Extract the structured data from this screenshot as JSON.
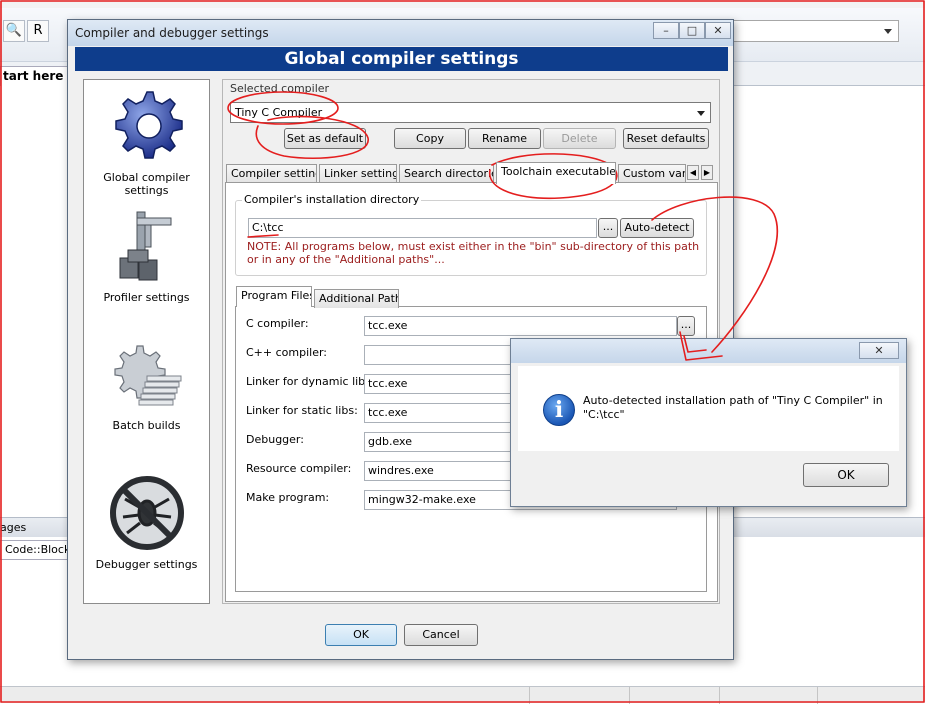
{
  "ide": {
    "tab_label": "tart here",
    "logs_header": "ages",
    "logs_tab": "Code::Blocks"
  },
  "dialog": {
    "title": "Compiler and debugger settings",
    "header": "Global compiler settings",
    "side_items": [
      {
        "label": "Global compiler settings",
        "icon": "gear-icon"
      },
      {
        "label": "Profiler settings",
        "icon": "caliper-icon"
      },
      {
        "label": "Batch builds",
        "icon": "batch-gear-icon"
      },
      {
        "label": "Debugger settings",
        "icon": "no-bug-icon"
      }
    ],
    "selected_compiler_label": "Selected compiler",
    "selected_compiler_value": "Tiny C Compiler",
    "buttons": {
      "set_default": "Set as default",
      "copy": "Copy",
      "rename": "Rename",
      "delete": "Delete",
      "reset": "Reset defaults"
    },
    "tabs": [
      "Compiler settings",
      "Linker settings",
      "Search directories",
      "Toolchain executables",
      "Custom variabl"
    ],
    "install_dir_legend": "Compiler's installation directory",
    "install_dir_value": "C:\\tcc",
    "browse_label": "...",
    "autodetect_label": "Auto-detect",
    "note_line1": "NOTE: All programs below, must exist either in the \"bin\" sub-directory of this path",
    "note_line2": "or in any of the \"Additional paths\"...",
    "subtabs": [
      "Program Files",
      "Additional Paths"
    ],
    "programs": [
      {
        "label": "C compiler:",
        "value": "tcc.exe"
      },
      {
        "label": "C++ compiler:",
        "value": ""
      },
      {
        "label": "Linker for dynamic libs:",
        "value": "tcc.exe"
      },
      {
        "label": "Linker for static libs:",
        "value": "tcc.exe"
      },
      {
        "label": "Debugger:",
        "value": "gdb.exe"
      },
      {
        "label": "Resource compiler:",
        "value": "windres.exe"
      },
      {
        "label": "Make program:",
        "value": "mingw32-make.exe"
      }
    ],
    "ok_label": "OK",
    "cancel_label": "Cancel"
  },
  "msgbox": {
    "text": "Auto-detected installation path of \"Tiny C Compiler\" in \"C:\\tcc\"",
    "ok_label": "OK",
    "close_label": "✕"
  },
  "colors": {
    "header_blue": "#0e3d8c",
    "annotation_red": "#e41e1e",
    "note_red": "#9b1c1c"
  }
}
